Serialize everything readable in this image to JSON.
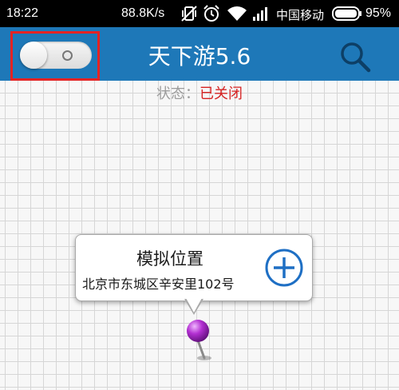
{
  "status_bar": {
    "time": "18:22",
    "network_speed": "88.8K/s",
    "carrier": "中国移动",
    "battery_percent": "95%",
    "icons": [
      "vibrate-off-icon",
      "alarm-icon",
      "wifi-icon",
      "signal-icon",
      "battery-icon"
    ]
  },
  "toolbar": {
    "title": "天下游5.6",
    "toggle_state": "off",
    "toggle_highlight_color": "#e52323",
    "background_color": "#1e78b8",
    "search_icon": "search-icon"
  },
  "status": {
    "label": "状态：",
    "value": "已关闭",
    "value_color": "#d62222"
  },
  "callout": {
    "title": "模拟位置",
    "address": "北京市东城区辛安里102号",
    "add_icon": "plus-circle-icon"
  },
  "map": {
    "pin_color": "#b22fd1",
    "pin_icon": "map-pin-icon"
  }
}
